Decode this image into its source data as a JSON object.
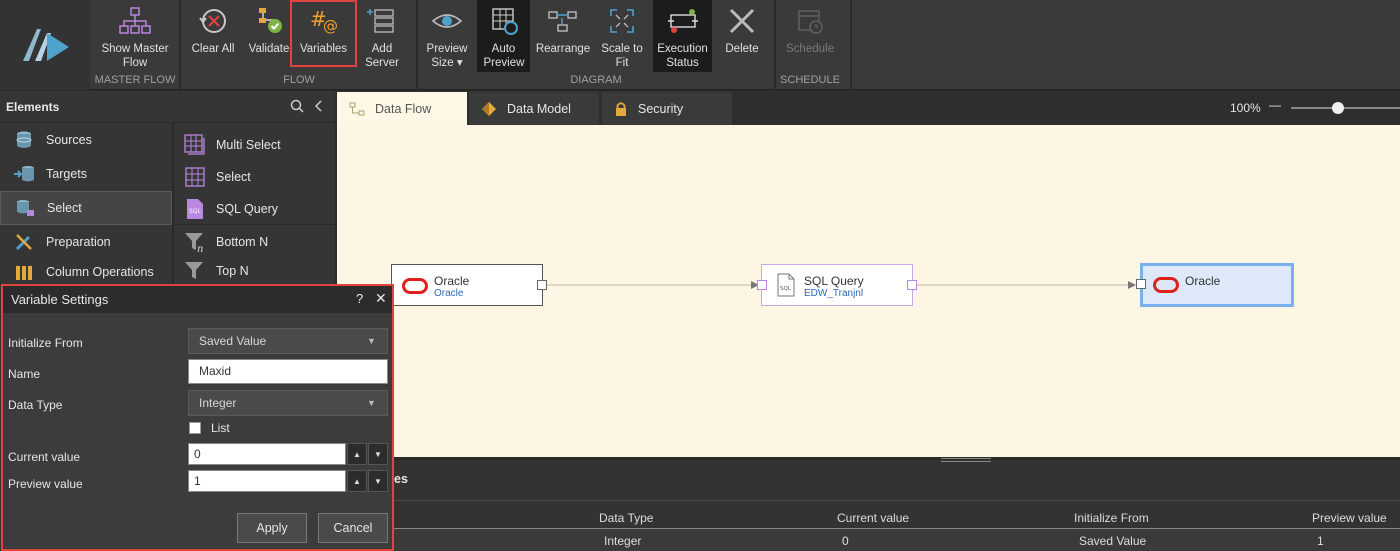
{
  "ribbon": {
    "buttons": {
      "show_master_flow": "Show Master Flow",
      "clear_all": "Clear All",
      "validate": "Validate",
      "variables": "Variables",
      "add_server": "Add Server",
      "preview_size": "Preview Size ▾",
      "auto_preview": "Auto Preview",
      "rearrange": "Rearrange",
      "scale_to_fit": "Scale to Fit",
      "execution_status": "Execution Status",
      "delete": "Delete",
      "schedule": "Schedule"
    },
    "groups": {
      "master_flow": "MASTER FLOW",
      "flow": "FLOW",
      "diagram": "DIAGRAM",
      "schedule": "SCHEDULE"
    }
  },
  "elements": {
    "title": "Elements",
    "categories": [
      "Sources",
      "Targets",
      "Select",
      "Preparation",
      "Column Operations"
    ],
    "tools": [
      "Multi Select",
      "Select",
      "SQL Query",
      "Bottom N",
      "Top N"
    ]
  },
  "tabs": [
    "Data Flow",
    "Data Model",
    "Security"
  ],
  "zoom": {
    "label": "100%",
    "minus": "—"
  },
  "canvas": {
    "nodes": [
      {
        "title": "Oracle",
        "subtitle": "Oracle"
      },
      {
        "title": "SQL Query",
        "subtitle": "EDW_Tranjnl"
      },
      {
        "title": "Oracle",
        "subtitle": ""
      }
    ]
  },
  "bottom_panel": {
    "title_fragment": "es",
    "columns": [
      "Data Type",
      "Current value",
      "Initialize From",
      "Preview value"
    ],
    "row": [
      "Integer",
      "0",
      "Saved Value",
      "1"
    ]
  },
  "dialog": {
    "title": "Variable Settings",
    "help": "?",
    "close": "✕",
    "labels": {
      "initialize_from": "Initialize From",
      "name": "Name",
      "data_type": "Data Type",
      "list": "List",
      "current_value": "Current value",
      "preview_value": "Preview value"
    },
    "values": {
      "initialize_from": "Saved Value",
      "name": "Maxid",
      "data_type": "Integer",
      "list_checked": false,
      "current_value": "0",
      "preview_value": "1"
    },
    "apply": "Apply",
    "cancel": "Cancel"
  },
  "colors": {
    "highlight": "#e2433f",
    "canvas_bg": "#fdf6e4",
    "link": "#2a6bb5",
    "oracle_red": "#e0201c",
    "selected_node": "#dde9f9"
  }
}
